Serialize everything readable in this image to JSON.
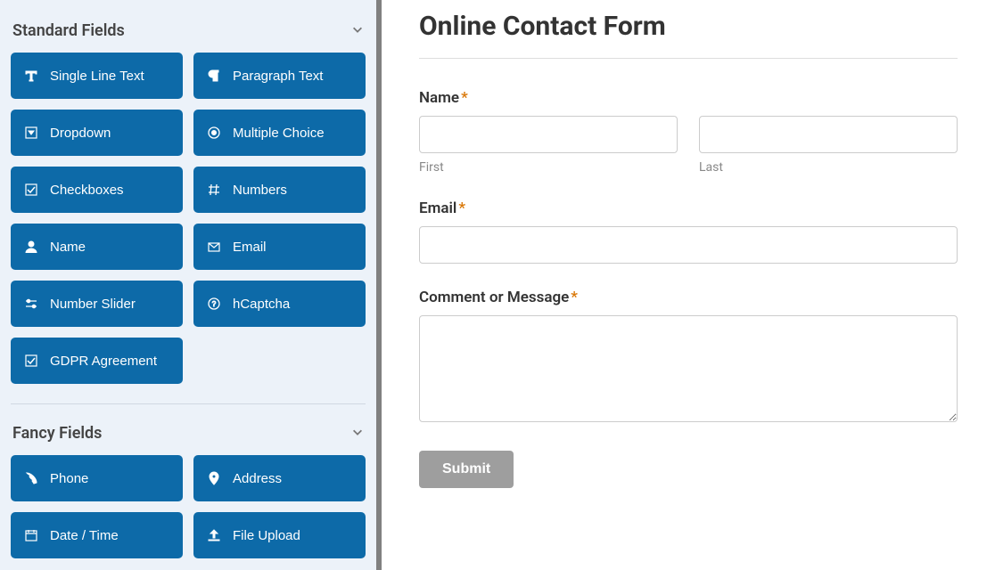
{
  "sidebar": {
    "sections": {
      "standard": {
        "title": "Standard Fields",
        "items": [
          {
            "label": "Single Line Text",
            "icon": "text-icon"
          },
          {
            "label": "Paragraph Text",
            "icon": "paragraph-icon"
          },
          {
            "label": "Dropdown",
            "icon": "caret-square-icon"
          },
          {
            "label": "Multiple Choice",
            "icon": "dot-circle-icon"
          },
          {
            "label": "Checkboxes",
            "icon": "check-square-icon"
          },
          {
            "label": "Numbers",
            "icon": "hashtag-icon"
          },
          {
            "label": "Name",
            "icon": "user-icon"
          },
          {
            "label": "Email",
            "icon": "envelope-icon"
          },
          {
            "label": "Number Slider",
            "icon": "sliders-icon"
          },
          {
            "label": "hCaptcha",
            "icon": "question-circle-icon"
          },
          {
            "label": "GDPR Agreement",
            "icon": "check-square-icon"
          }
        ]
      },
      "fancy": {
        "title": "Fancy Fields",
        "items": [
          {
            "label": "Phone",
            "icon": "phone-icon"
          },
          {
            "label": "Address",
            "icon": "map-marker-icon"
          },
          {
            "label": "Date / Time",
            "icon": "calendar-icon"
          },
          {
            "label": "File Upload",
            "icon": "upload-icon"
          }
        ]
      }
    }
  },
  "form": {
    "title": "Online Contact Form",
    "fields": {
      "name": {
        "label": "Name",
        "required": true,
        "first_sub": "First",
        "last_sub": "Last"
      },
      "email": {
        "label": "Email",
        "required": true
      },
      "message": {
        "label": "Comment or Message",
        "required": true
      }
    },
    "submit_label": "Submit"
  }
}
